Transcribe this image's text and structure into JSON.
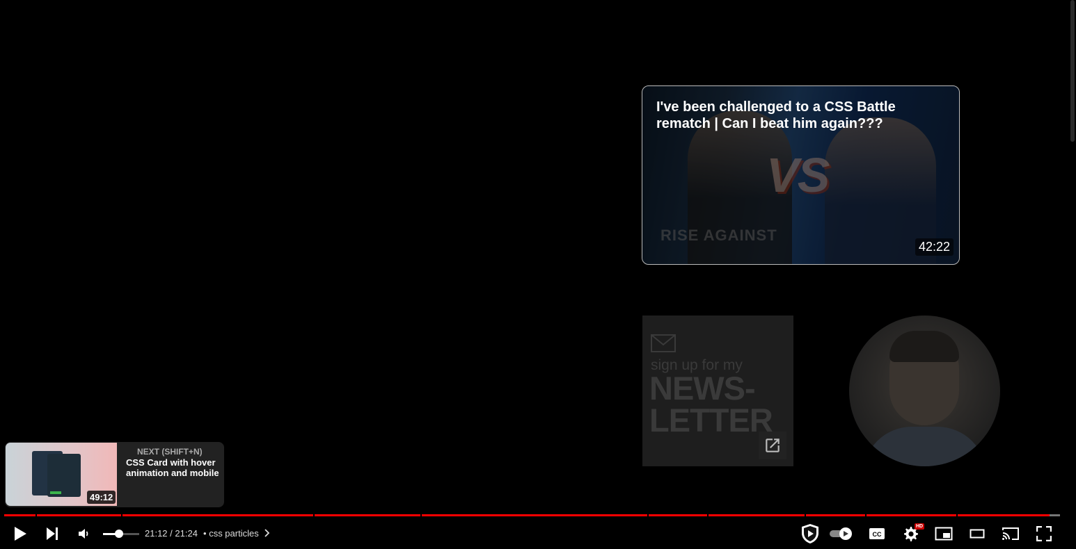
{
  "end_screen": {
    "video": {
      "title": "I've been challenged to a CSS Battle rematch | Can I beat him again???",
      "duration": "42:22",
      "thumb_text_vs": "VS",
      "thumb_text_shirt": "RISE AGAINST"
    },
    "newsletter": {
      "sub": "sign up for my",
      "big_line1": "NEWS-",
      "big_line2": "LETTER"
    }
  },
  "up_next": {
    "label": "NEXT (SHIFT+N)",
    "title": "CSS Card with hover animation and mobile",
    "duration": "49:12"
  },
  "player": {
    "current_time": "21:12",
    "total_time": "21:24",
    "time_display": "21:12 / 21:24",
    "chapter_separator": "•",
    "chapter": "css particles",
    "progress_fraction": 0.99,
    "volume_fraction": 0.45,
    "settings_badge": "HD",
    "accent_color": "#ff0000"
  },
  "icons": [
    "play-icon",
    "next-icon",
    "volume-icon",
    "chevron-right-icon",
    "sponsor-shield-icon",
    "autoplay-toggle-icon",
    "captions-icon",
    "settings-icon",
    "miniplayer-icon",
    "theater-icon",
    "cast-icon",
    "fullscreen-icon",
    "external-link-icon",
    "mail-icon"
  ]
}
